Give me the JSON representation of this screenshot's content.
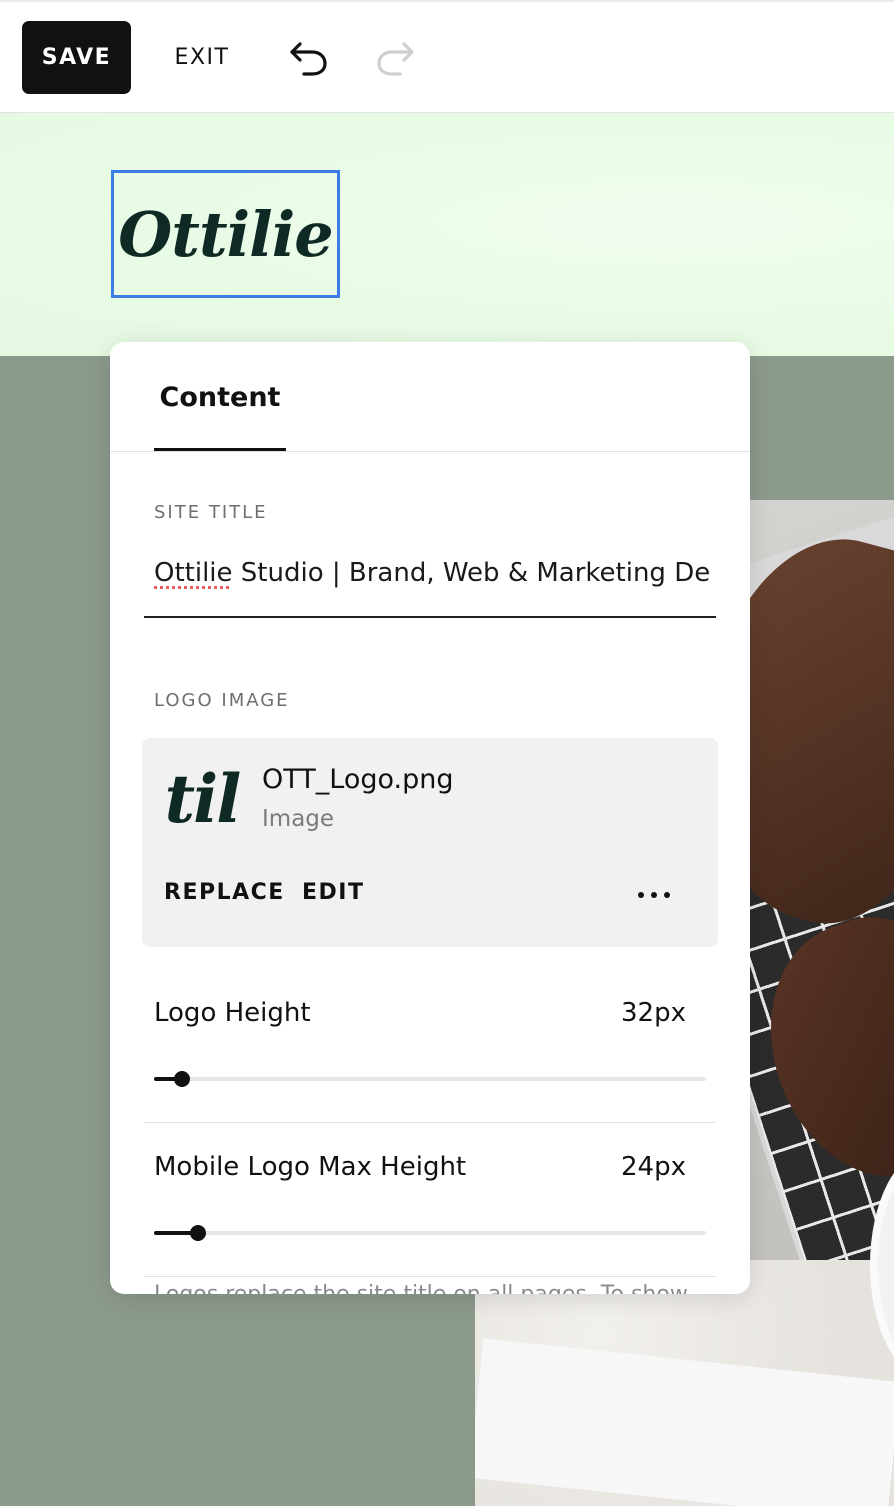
{
  "toolbar": {
    "save_label": "SAVE",
    "exit_label": "EXIT",
    "undo_icon": "undo-arrow-icon",
    "redo_icon": "redo-arrow-icon",
    "redo_enabled": false
  },
  "header": {
    "logo_text": "Ottilie",
    "band_color": "#e8fbe5",
    "selection_color": "#3b7ce6"
  },
  "panel": {
    "tabs": [
      {
        "label": "Content",
        "active": true
      }
    ],
    "site_title": {
      "label": "SITE TITLE",
      "value": "Ottilie Studio | Brand, Web & Marketing De",
      "value_first_word": "Ottilie",
      "value_rest": " Studio | Brand, Web & Marketing De"
    },
    "logo_image": {
      "label": "LOGO IMAGE",
      "thumb_text": "til",
      "file_name": "OTT_Logo.png",
      "file_type": "Image",
      "actions": {
        "replace": "REPLACE",
        "edit": "EDIT",
        "more_icon": "more-horizontal-icon"
      }
    },
    "settings": [
      {
        "label": "Logo Height",
        "value": "32px",
        "fraction": 0.05
      },
      {
        "label": "Mobile Logo Max Height",
        "value": "24px",
        "fraction": 0.08
      }
    ],
    "footer_text": "Logos replace the site title on all pages. To show"
  },
  "colors": {
    "page_background": "#8c9a8c",
    "save_button_bg": "#111111",
    "panel_bg": "#ffffff",
    "card_bg": "#f1f1f1"
  }
}
